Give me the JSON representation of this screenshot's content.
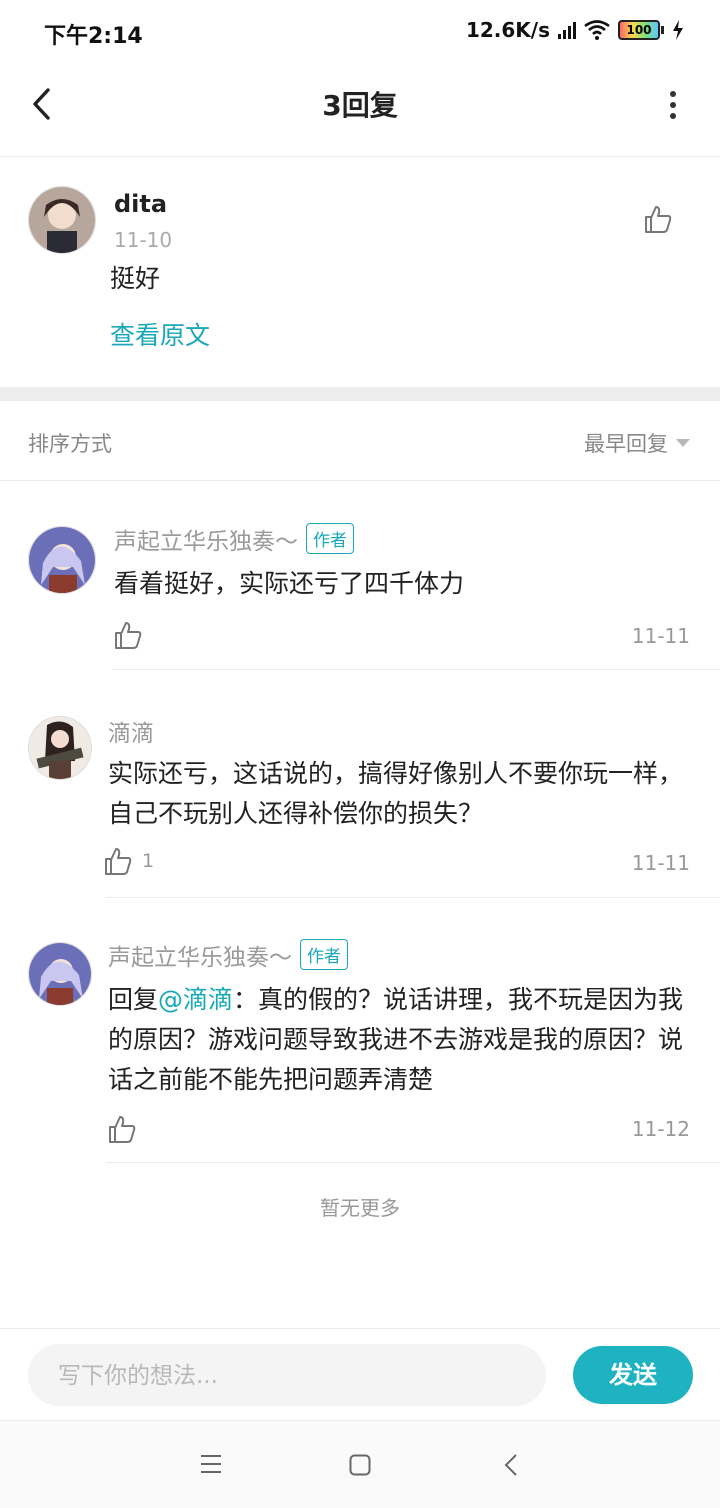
{
  "status_bar": {
    "time": "下午2:14",
    "speed": "12.6K/s",
    "battery": "100"
  },
  "header": {
    "title": "3回复"
  },
  "original_post": {
    "username": "dita",
    "date": "11-10",
    "content": "挺好",
    "view_original": "查看原文"
  },
  "sort": {
    "label": "排序方式",
    "value": "最早回复"
  },
  "replies": [
    {
      "username": "声起立华乐独奏～",
      "badge": "作者",
      "content": "看着挺好，实际还亏了四千体力",
      "likes": "",
      "date": "11-11"
    },
    {
      "username": "滴滴",
      "badge": "",
      "content": "实际还亏，这话说的，搞得好像别人不要你玩一样，自己不玩别人还得补偿你的损失？",
      "likes": "1",
      "date": "11-11"
    },
    {
      "username": "声起立华乐独奏～",
      "badge": "作者",
      "reply_prefix": "回复",
      "mention": "@滴滴",
      "content": "：真的假的？说话讲理，我不玩是因为我的原因？游戏问题导致我进不去游戏是我的原因？说话之前能不能先把问题弄清楚",
      "likes": "",
      "date": "11-12"
    }
  ],
  "footer": {
    "no_more": "暂无更多"
  },
  "composer": {
    "placeholder": "写下你的想法...",
    "send_label": "发送"
  },
  "colors": {
    "accent": "#19a8b8",
    "send_button": "#1fb3c2"
  },
  "icons": [
    "back-arrow-icon",
    "more-vertical-icon",
    "thumbs-up-icon",
    "menu-icon",
    "home-square-icon",
    "nav-back-icon"
  ]
}
